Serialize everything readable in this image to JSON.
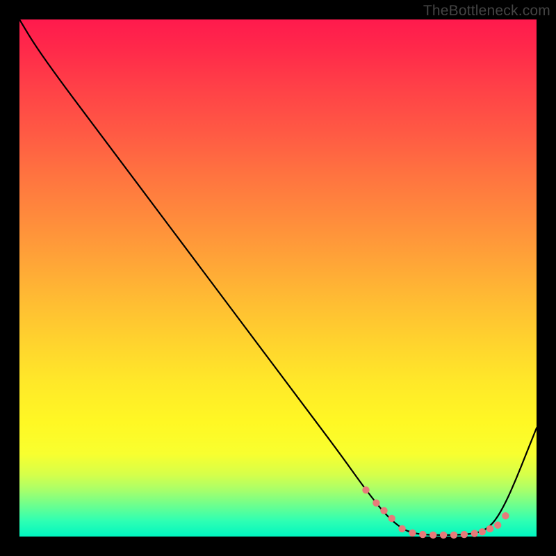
{
  "watermark": "TheBottleneck.com",
  "colors": {
    "background": "#000000",
    "gradient_top": "#ff1a4d",
    "gradient_bottom": "#00f5c0",
    "curve": "#000000",
    "markers": "#e77a7a"
  },
  "chart_data": {
    "type": "line",
    "title": "",
    "xlabel": "",
    "ylabel": "",
    "xlim": [
      0,
      100
    ],
    "ylim": [
      0,
      100
    ],
    "x": [
      0,
      3,
      8,
      14,
      20,
      26,
      32,
      38,
      44,
      50,
      56,
      62,
      67,
      71,
      74,
      76,
      78,
      80,
      82,
      84,
      86,
      88,
      90,
      92,
      94,
      96,
      98,
      100
    ],
    "values": [
      100,
      95,
      88,
      80,
      72,
      64,
      56,
      48,
      40,
      32,
      24,
      16,
      9,
      4,
      1.5,
      0.7,
      0.4,
      0.3,
      0.3,
      0.3,
      0.4,
      0.6,
      1.2,
      3.0,
      6.5,
      11,
      16,
      21
    ],
    "markers_x": [
      67,
      69,
      70.5,
      72,
      74,
      76,
      78,
      80,
      82,
      84,
      86,
      88,
      89.5,
      91,
      92.5,
      94
    ],
    "markers_y": [
      9,
      6.5,
      5,
      3.5,
      1.5,
      0.7,
      0.4,
      0.3,
      0.3,
      0.3,
      0.4,
      0.6,
      0.9,
      1.5,
      2.2,
      4.0
    ],
    "annotations": []
  }
}
